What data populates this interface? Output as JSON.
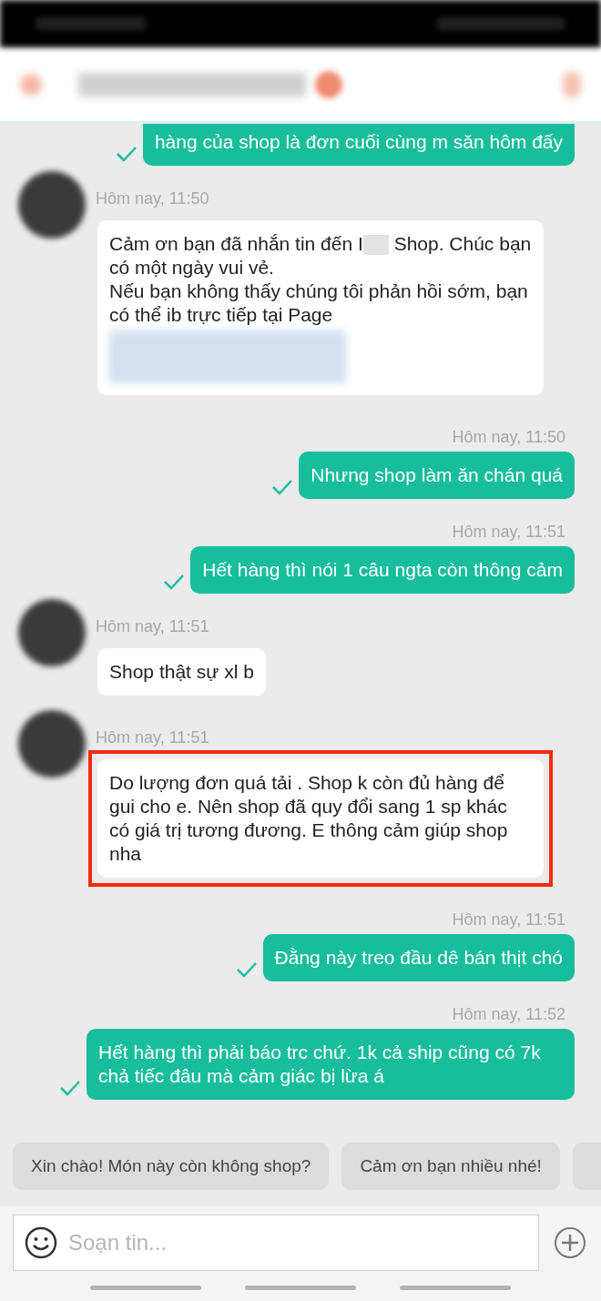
{
  "messages": [
    {
      "kind": "outgoing",
      "lines": [
        "hàng của shop là đơn cuối cùng m săn hôm đấy"
      ],
      "delivered": true
    },
    {
      "kind": "incoming",
      "time": "Hôm nay, 11:50",
      "segments": [
        {
          "kind": "text",
          "text": "Cảm ơn bạn đã nhắn tin đến I"
        },
        {
          "kind": "redacted"
        },
        {
          "kind": "text",
          "text": " Shop. Chúc bạn có một ngày vui vẻ.\nNếu bạn không thấy chúng tôi phản hồi sớm, bạn có thể ib trực tiếp tại Page"
        },
        {
          "kind": "blurred"
        }
      ],
      "highlighted": false
    },
    {
      "kind": "outgoing",
      "time": "Hôm nay, 11:50",
      "lines": [
        "Nhưng shop làm ăn chán quá"
      ],
      "delivered": true
    },
    {
      "kind": "outgoing",
      "time": "Hôm nay, 11:51",
      "lines": [
        "Hết hàng thì nói 1 câu ngta còn thông cảm"
      ],
      "delivered": true
    },
    {
      "kind": "incoming",
      "time": "Hôm nay, 11:51",
      "segments": [
        {
          "kind": "text",
          "text": "Shop thật sự xl b"
        }
      ],
      "highlighted": false
    },
    {
      "kind": "incoming",
      "time": "Hôm nay, 11:51",
      "segments": [
        {
          "kind": "text",
          "text": "Do lượng đơn quá tải . Shop k còn đủ hàng để gui cho e. Nên shop đã quy đổi sang 1 sp khác có giá trị tương đương. E thông cảm giúp shop nha"
        }
      ],
      "highlighted": true
    },
    {
      "kind": "outgoing",
      "time": "Hôm nay, 11:51",
      "lines": [
        "Đằng này treo đầu dê bán thịt chó"
      ],
      "delivered": true
    },
    {
      "kind": "outgoing",
      "time": "Hôm nay, 11:52",
      "lines": [
        "Hết hàng thì phải báo trc chứ. 1k cả ship cũng có 7k chả tiếc đâu mà cảm giác bị lừa á"
      ],
      "delivered": true
    }
  ],
  "quick_replies": [
    "Xin chào! Món này còn không shop?",
    "Cảm ơn bạn nhiều nhé!"
  ],
  "composer": {
    "placeholder": "Soạn tin..."
  }
}
